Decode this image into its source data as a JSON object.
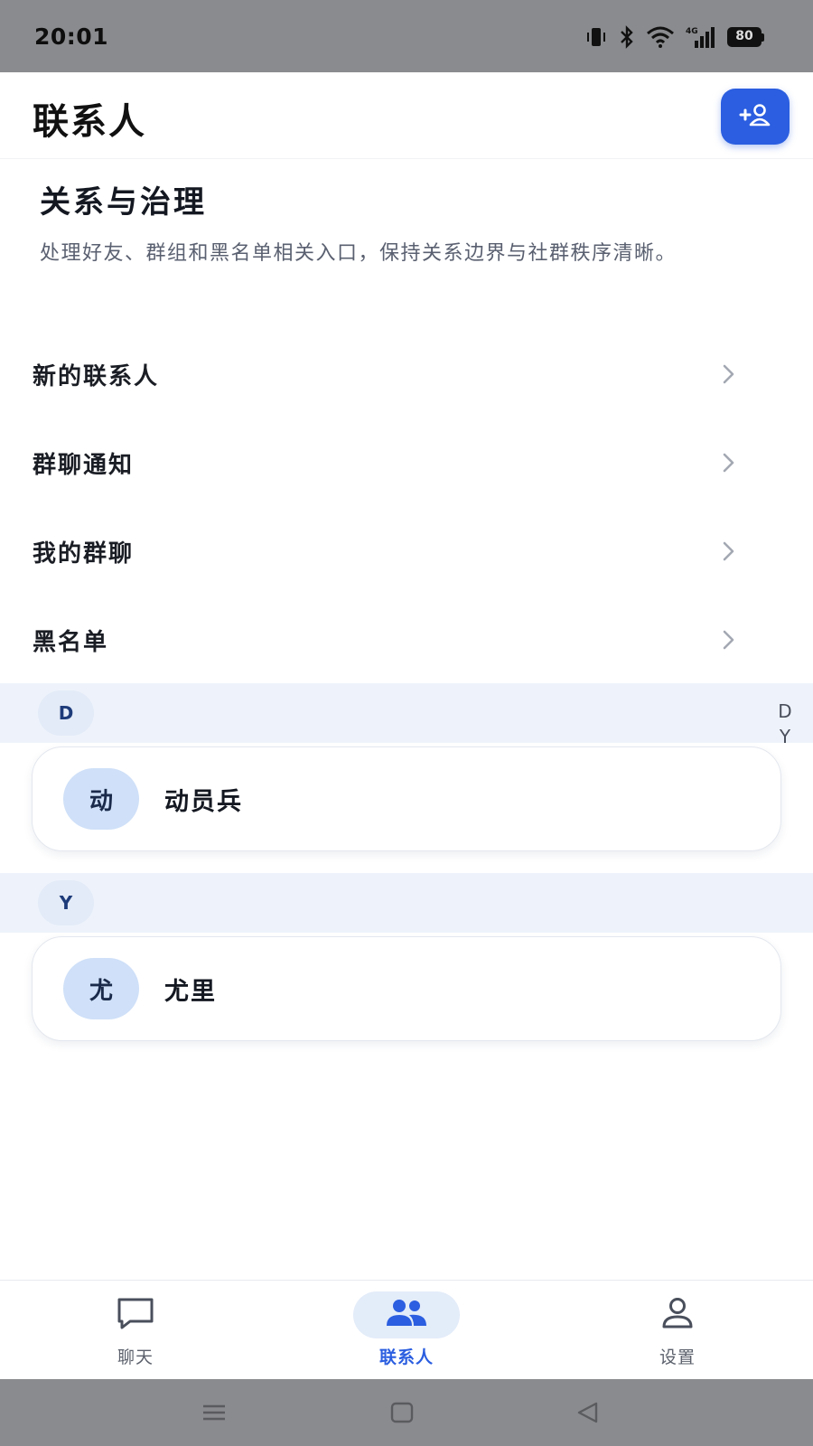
{
  "status_bar": {
    "time": "20:01",
    "battery": "80",
    "icons": [
      "vibrate-icon",
      "bluetooth-icon",
      "wifi-icon",
      "signal-4g-icon",
      "battery-icon"
    ]
  },
  "header": {
    "title": "联系人",
    "add_button_icon": "add-contact-icon"
  },
  "governance": {
    "title": "关系与治理",
    "description": "处理好友、群组和黑名单相关入口，保持关系边界与社群秩序清晰。",
    "items": [
      {
        "label": "新的联系人"
      },
      {
        "label": "群聊通知"
      },
      {
        "label": "我的群聊"
      },
      {
        "label": "黑名单"
      }
    ]
  },
  "contact_groups": [
    {
      "letter": "D",
      "contacts": [
        {
          "avatar": "动",
          "name": "动员兵"
        }
      ]
    },
    {
      "letter": "Y",
      "contacts": [
        {
          "avatar": "尤",
          "name": "尤里"
        }
      ]
    }
  ],
  "index_bar": [
    "D",
    "Y"
  ],
  "bottom_nav": {
    "tabs": [
      {
        "label": "聊天",
        "icon": "chat-bubble-icon",
        "active": false
      },
      {
        "label": "联系人",
        "icon": "contacts-icon",
        "active": true
      },
      {
        "label": "设置",
        "icon": "person-icon",
        "active": false
      }
    ]
  },
  "colors": {
    "accent": "#2b5ee0",
    "letter_header_bg": "#eef3fb",
    "avatar_bg": "#cfe0f8",
    "system_bar": "#8a8b8e"
  }
}
